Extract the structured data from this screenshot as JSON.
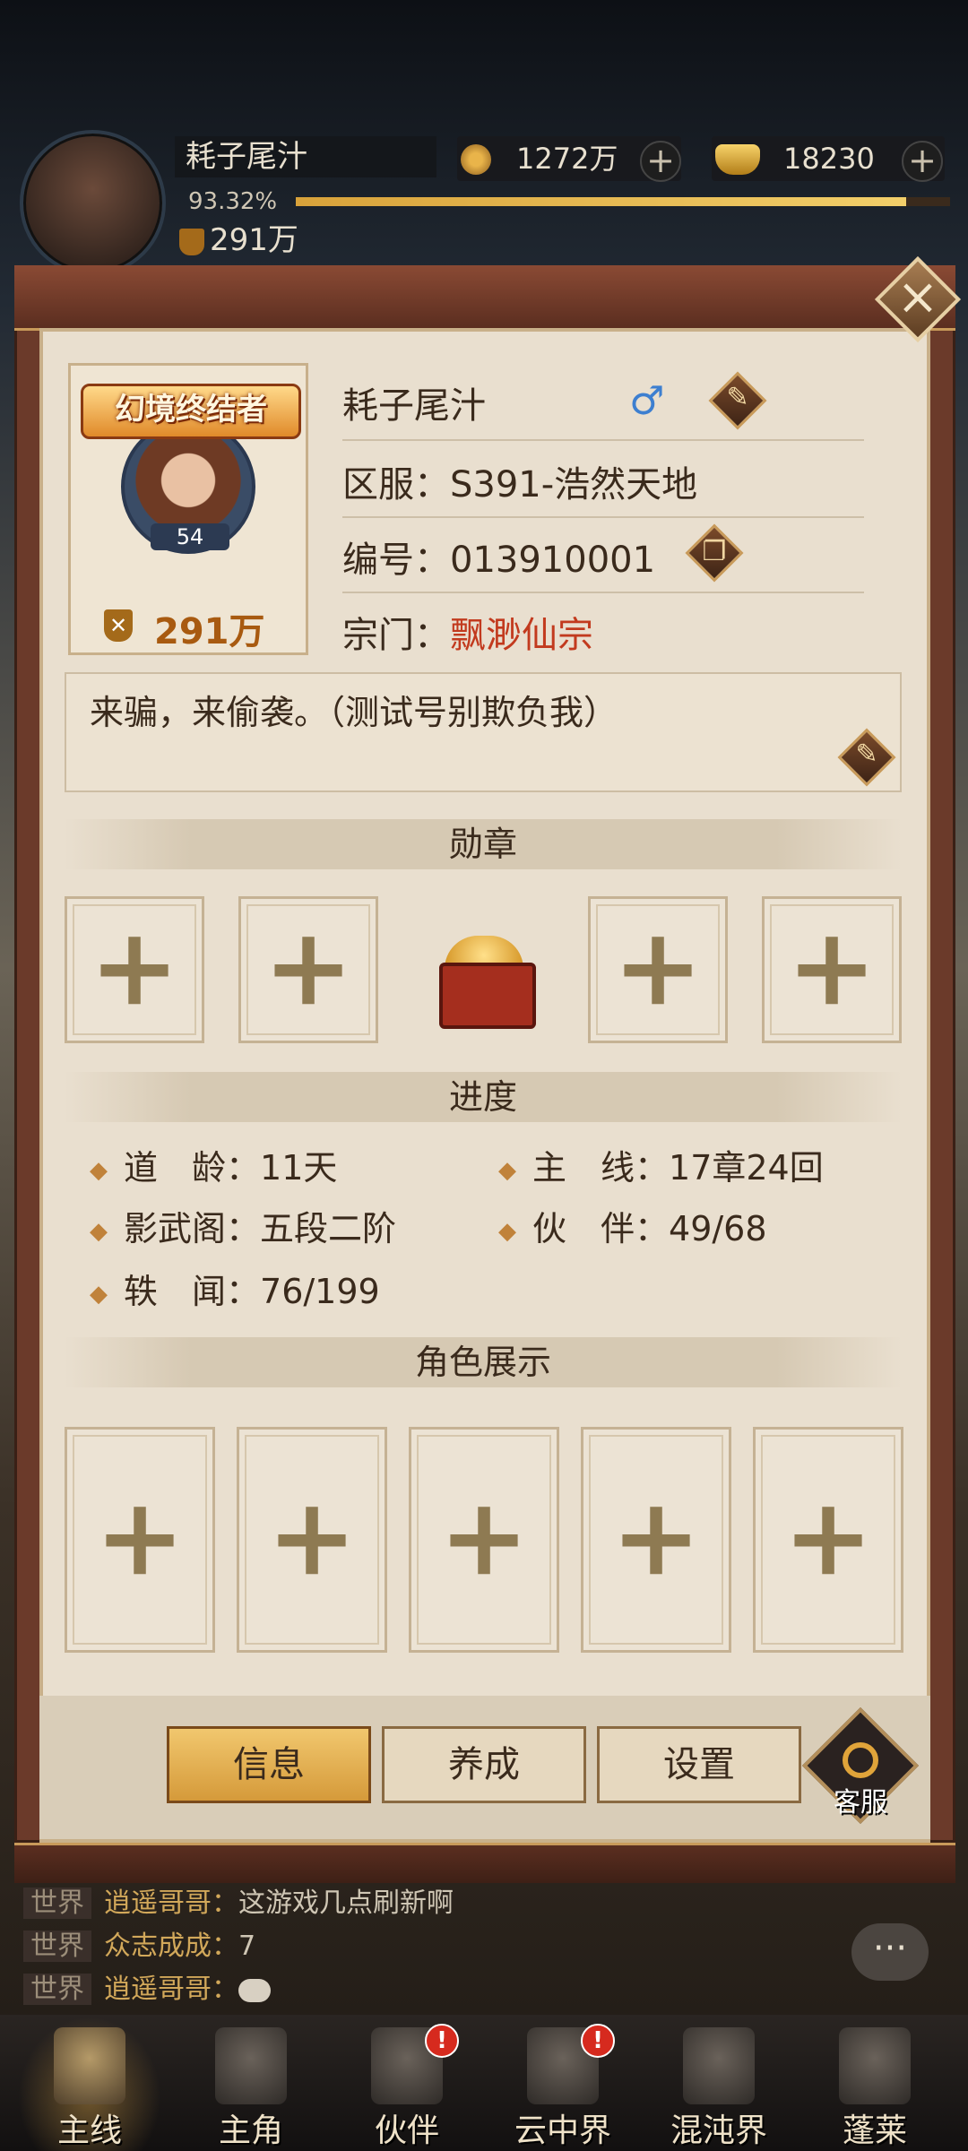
{
  "hud": {
    "player_name": "耗子尾汁",
    "exp_percent_text": "93.32%",
    "exp_fraction": 0.9332,
    "power": "291万",
    "level": "54",
    "copper": "1272万",
    "gold": "18230",
    "plus": "+"
  },
  "profile": {
    "title_badge": "幻境终结者",
    "level": "54",
    "power": "291万",
    "name": "耗子尾汁",
    "gender_symbol": "♂",
    "server_label": "区服：",
    "server_value": "S391-浩然天地",
    "id_label": "编号：",
    "id_value": "013910001",
    "sect_label": "宗门：",
    "sect_value": "飘渺仙宗",
    "signature": "来骗，来偷袭。（测试号别欺负我）",
    "close": "×"
  },
  "sections": {
    "medals": "勋章",
    "progress": "进度",
    "showcase": "角色展示"
  },
  "progress": {
    "dao_age_label": "道　龄：",
    "dao_age_value": "11天",
    "mainline_label": "主　线：",
    "mainline_value": "17章24回",
    "shadow_label": "影武阁：",
    "shadow_value": "五段二阶",
    "partner_label": "伙　伴：",
    "partner_value": "49/68",
    "lore_label": "轶　闻：",
    "lore_value": "76/199"
  },
  "slot_plus": "+",
  "tabs": {
    "info": "信息",
    "develop": "养成",
    "settings": "设置",
    "service": "客服"
  },
  "chat": [
    {
      "channel": "世界",
      "sender": "逍遥哥哥：",
      "message": "这游戏几点刷新啊"
    },
    {
      "channel": "世界",
      "sender": "众志成成：",
      "message": "7"
    },
    {
      "channel": "世界",
      "sender": "逍遥哥哥：",
      "message": ""
    }
  ],
  "chat_bubble": "···",
  "nav": [
    {
      "label": "主线",
      "badge": ""
    },
    {
      "label": "主角",
      "badge": ""
    },
    {
      "label": "伙伴",
      "badge": "!"
    },
    {
      "label": "云中界",
      "badge": "!"
    },
    {
      "label": "混沌界",
      "badge": ""
    },
    {
      "label": "蓬莱",
      "badge": ""
    }
  ],
  "colors": {
    "accent": "#d59a3a",
    "sect": "#c23a1e",
    "panel": "#e9dfcf"
  }
}
